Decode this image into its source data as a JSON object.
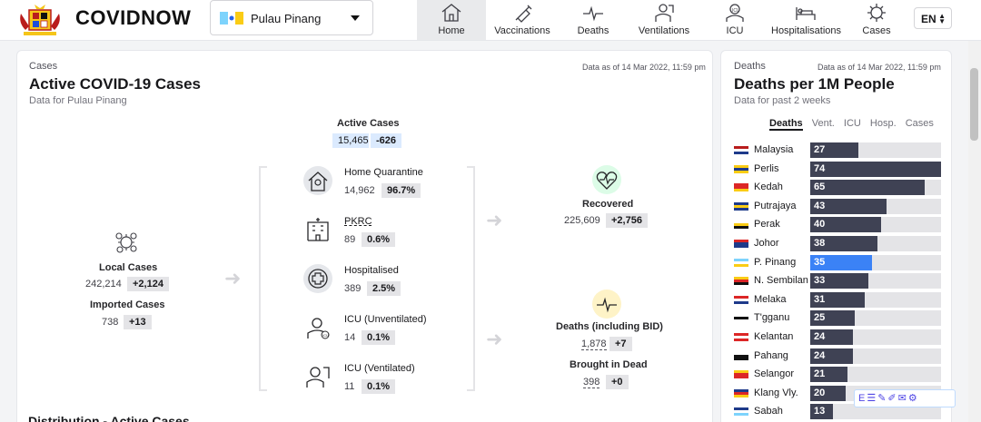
{
  "header": {
    "brand": "COVIDNOW",
    "state_select": {
      "value": "Pulau Pinang"
    },
    "nav": [
      {
        "label": "Home",
        "icon": "home-icon",
        "active": true
      },
      {
        "label": "Vaccinations",
        "icon": "syringe-icon"
      },
      {
        "label": "Deaths",
        "icon": "pulse-icon"
      },
      {
        "label": "Ventilations",
        "icon": "ventilation-icon"
      },
      {
        "label": "ICU",
        "icon": "icu-icon"
      },
      {
        "label": "Hospitalisations",
        "icon": "hospital-bed-icon"
      },
      {
        "label": "Cases",
        "icon": "virus-icon"
      }
    ],
    "language": "EN"
  },
  "cases": {
    "kicker": "Cases",
    "title": "Active COVID-19 Cases",
    "subtitle": "Data for Pulau Pinang",
    "as_of": "Data as of 14 Mar 2022, 11:59 pm",
    "active": {
      "label": "Active Cases",
      "value": "15,465",
      "delta": "-626"
    },
    "local": {
      "label": "Local Cases",
      "value": "242,214",
      "delta": "+2,124"
    },
    "imported": {
      "label": "Imported Cases",
      "value": "738",
      "delta": "+13"
    },
    "breakdown": [
      {
        "label": "Home Quarantine",
        "value": "14,962",
        "pct": "96.7%"
      },
      {
        "label": "PKRC",
        "value": "89",
        "pct": "0.6%"
      },
      {
        "label": "Hospitalised",
        "value": "389",
        "pct": "2.5%"
      },
      {
        "label": "ICU (Unventilated)",
        "value": "14",
        "pct": "0.1%"
      },
      {
        "label": "ICU (Ventilated)",
        "value": "11",
        "pct": "0.1%"
      }
    ],
    "recovered": {
      "label": "Recovered",
      "value": "225,609",
      "delta": "+2,756"
    },
    "deaths": {
      "label": "Deaths (including BID)",
      "value": "1,878",
      "delta": "+7"
    },
    "bid": {
      "label": "Brought in Dead",
      "value": "398",
      "delta": "+0"
    },
    "next_section": "Distribution - Active Cases"
  },
  "deaths_panel": {
    "kicker": "Deaths",
    "as_of": "Data as of 14 Mar 2022, 11:59 pm",
    "title": "Deaths per 1M People",
    "subtitle": "Data for past 2 weeks",
    "tabs": [
      "Deaths",
      "Vent.",
      "ICU",
      "Hosp.",
      "Cases"
    ],
    "active_tab": "Deaths",
    "scale_max": 74,
    "rows": [
      {
        "name": "Malaysia",
        "value": 27
      },
      {
        "name": "Perlis",
        "value": 74
      },
      {
        "name": "Kedah",
        "value": 65
      },
      {
        "name": "Putrajaya",
        "value": 43
      },
      {
        "name": "Perak",
        "value": 40
      },
      {
        "name": "Johor",
        "value": 38
      },
      {
        "name": "P. Pinang",
        "value": 35,
        "highlight": true
      },
      {
        "name": "N. Sembilan",
        "value": 33
      },
      {
        "name": "Melaka",
        "value": 31
      },
      {
        "name": "T'gganu",
        "value": 25
      },
      {
        "name": "Kelantan",
        "value": 24
      },
      {
        "name": "Pahang",
        "value": 24
      },
      {
        "name": "Selangor",
        "value": 21
      },
      {
        "name": "Klang Vly.",
        "value": 20
      },
      {
        "name": "Sabah",
        "value": 13
      }
    ]
  },
  "colors": {
    "bar": "#3f4254",
    "highlight": "#3b82f6",
    "track": "#e4e4e7"
  }
}
